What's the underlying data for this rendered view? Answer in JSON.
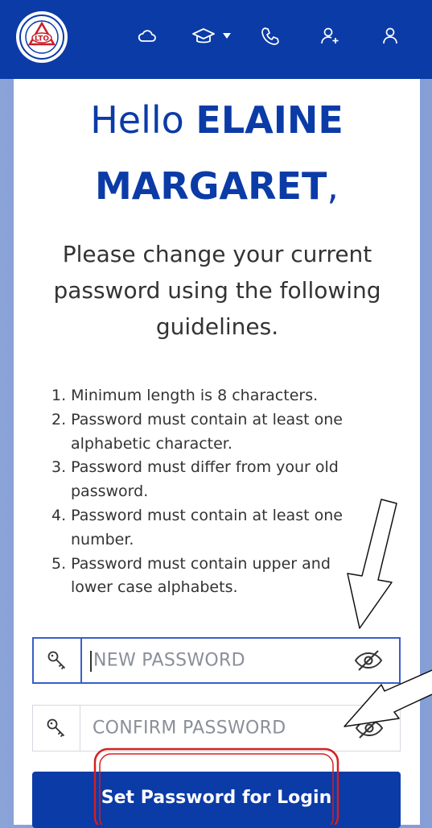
{
  "header": {
    "logo_text": "LTO",
    "icons": [
      "cloud-icon",
      "graduation-cap-icon",
      "phone-icon",
      "add-user-icon",
      "user-icon"
    ]
  },
  "greeting": {
    "hello": "Hello ",
    "first_line_name": "ELAINE",
    "second_line_name": "MARGARET",
    "comma": ","
  },
  "intro": "Please change your current password using the following guidelines.",
  "guidelines": [
    "1. Minimum length is 8 characters.",
    "2. Password must contain at least one alphabetic character.",
    "3. Password must differ from your old password.",
    "4. Password must contain at least one number.",
    "5. Password must contain upper and lower case alphabets."
  ],
  "form": {
    "new_password_placeholder": "NEW PASSWORD",
    "confirm_password_placeholder": "CONFIRM PASSWORD",
    "submit_label": "Set Password for Login"
  },
  "colors": {
    "brand_blue": "#0b3ba7",
    "annotation_red": "#d42020"
  }
}
